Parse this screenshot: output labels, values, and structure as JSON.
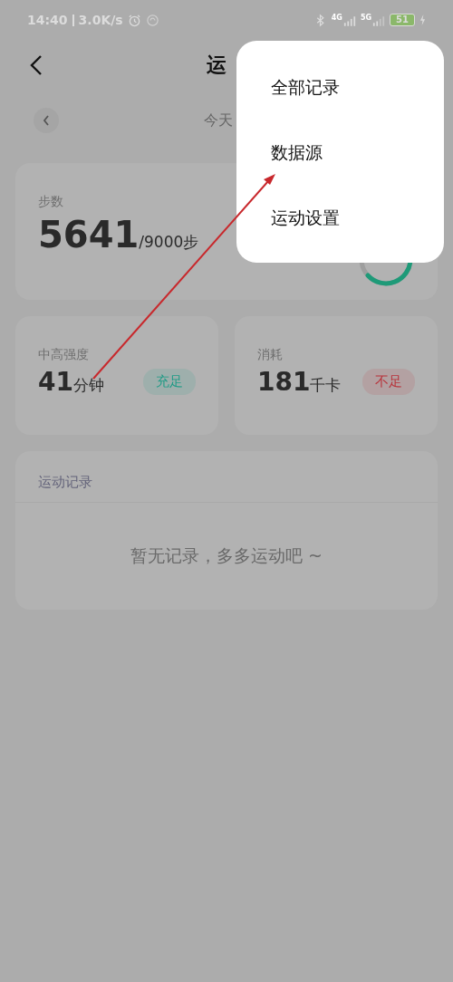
{
  "status_bar": {
    "time": "14:40",
    "speed": "3.0K/s",
    "network_1": "4G",
    "network_2": "5G",
    "battery": "51"
  },
  "header": {
    "title": "运"
  },
  "date_nav": {
    "label": "今天"
  },
  "steps_card": {
    "label": "步数",
    "value": "5641",
    "goal": "/9000步"
  },
  "stat_cards": [
    {
      "label": "中高强度",
      "value": "41",
      "unit": "分钟",
      "badge": "充足",
      "color": "#1f9b86"
    },
    {
      "label": "消耗",
      "value": "181",
      "unit": "千卡",
      "badge": "不足",
      "color": "#b8323a"
    }
  ],
  "records_card": {
    "title": "运动记录",
    "empty_text": "暂无记录，多多运动吧 ~"
  },
  "menu": {
    "items": [
      {
        "label": "全部记录"
      },
      {
        "label": "数据源"
      },
      {
        "label": "运动设置"
      }
    ]
  }
}
